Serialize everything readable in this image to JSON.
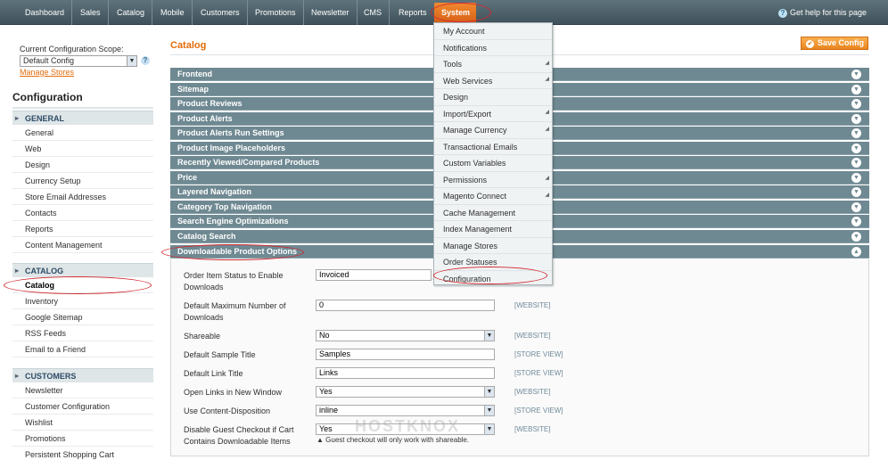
{
  "topnav": {
    "items": [
      "Dashboard",
      "Sales",
      "Catalog",
      "Mobile",
      "Customers",
      "Promotions",
      "Newsletter",
      "CMS",
      "Reports",
      "System"
    ],
    "active": "System",
    "help": "Get help for this page"
  },
  "sidebar": {
    "scope_label": "Current Configuration Scope:",
    "scope_value": "Default Config",
    "manage_stores": "Manage Stores",
    "title": "Configuration",
    "groups": [
      {
        "header": "GENERAL",
        "items": [
          "General",
          "Web",
          "Design",
          "Currency Setup",
          "Store Email Addresses",
          "Contacts",
          "Reports",
          "Content Management"
        ]
      },
      {
        "header": "CATALOG",
        "items": [
          "Catalog",
          "Inventory",
          "Google Sitemap",
          "RSS Feeds",
          "Email to a Friend"
        ]
      },
      {
        "header": "CUSTOMERS",
        "items": [
          "Newsletter",
          "Customer Configuration",
          "Wishlist",
          "Promotions",
          "Persistent Shopping Cart"
        ]
      }
    ]
  },
  "main": {
    "title": "Catalog",
    "save_label": "Save Config",
    "sections": [
      "Frontend",
      "Sitemap",
      "Product Reviews",
      "Product Alerts",
      "Product Alerts Run Settings",
      "Product Image Placeholders",
      "Recently Viewed/Compared Products",
      "Price",
      "Layered Navigation",
      "Category Top Navigation",
      "Search Engine Optimizations",
      "Catalog Search",
      "Downloadable Product Options"
    ],
    "fields": [
      {
        "label": "Order Item Status to Enable Downloads",
        "value": "Invoiced",
        "type": "select",
        "scope": ""
      },
      {
        "label": "Default Maximum Number of Downloads",
        "value": "0",
        "type": "input",
        "scope": "[WEBSITE]"
      },
      {
        "label": "Shareable",
        "value": "No",
        "type": "select",
        "scope": "[WEBSITE]"
      },
      {
        "label": "Default Sample Title",
        "value": "Samples",
        "type": "input",
        "scope": "[STORE VIEW]"
      },
      {
        "label": "Default Link Title",
        "value": "Links",
        "type": "input",
        "scope": "[STORE VIEW]"
      },
      {
        "label": "Open Links in New Window",
        "value": "Yes",
        "type": "select",
        "scope": "[WEBSITE]"
      },
      {
        "label": "Use Content-Disposition",
        "value": "inline",
        "type": "select",
        "scope": "[STORE VIEW]"
      },
      {
        "label": "Disable Guest Checkout if Cart Contains Downloadable Items",
        "value": "Yes",
        "type": "select",
        "scope": "[WEBSITE]"
      }
    ],
    "note": "▲ Guest checkout will only work with shareable."
  },
  "system_menu": {
    "items": [
      "My Account",
      "Notifications",
      "Tools",
      "Web Services",
      "Design",
      "Import/Export",
      "Manage Currency",
      "Transactional Emails",
      "Custom Variables",
      "Permissions",
      "Magento Connect",
      "Cache Management",
      "Index Management",
      "Manage Stores",
      "Order Statuses",
      "Configuration"
    ],
    "has_submenu": [
      "Tools",
      "Web Services",
      "Import/Export",
      "Manage Currency",
      "Permissions",
      "Magento Connect"
    ]
  },
  "watermark": "HOSTKNOX"
}
